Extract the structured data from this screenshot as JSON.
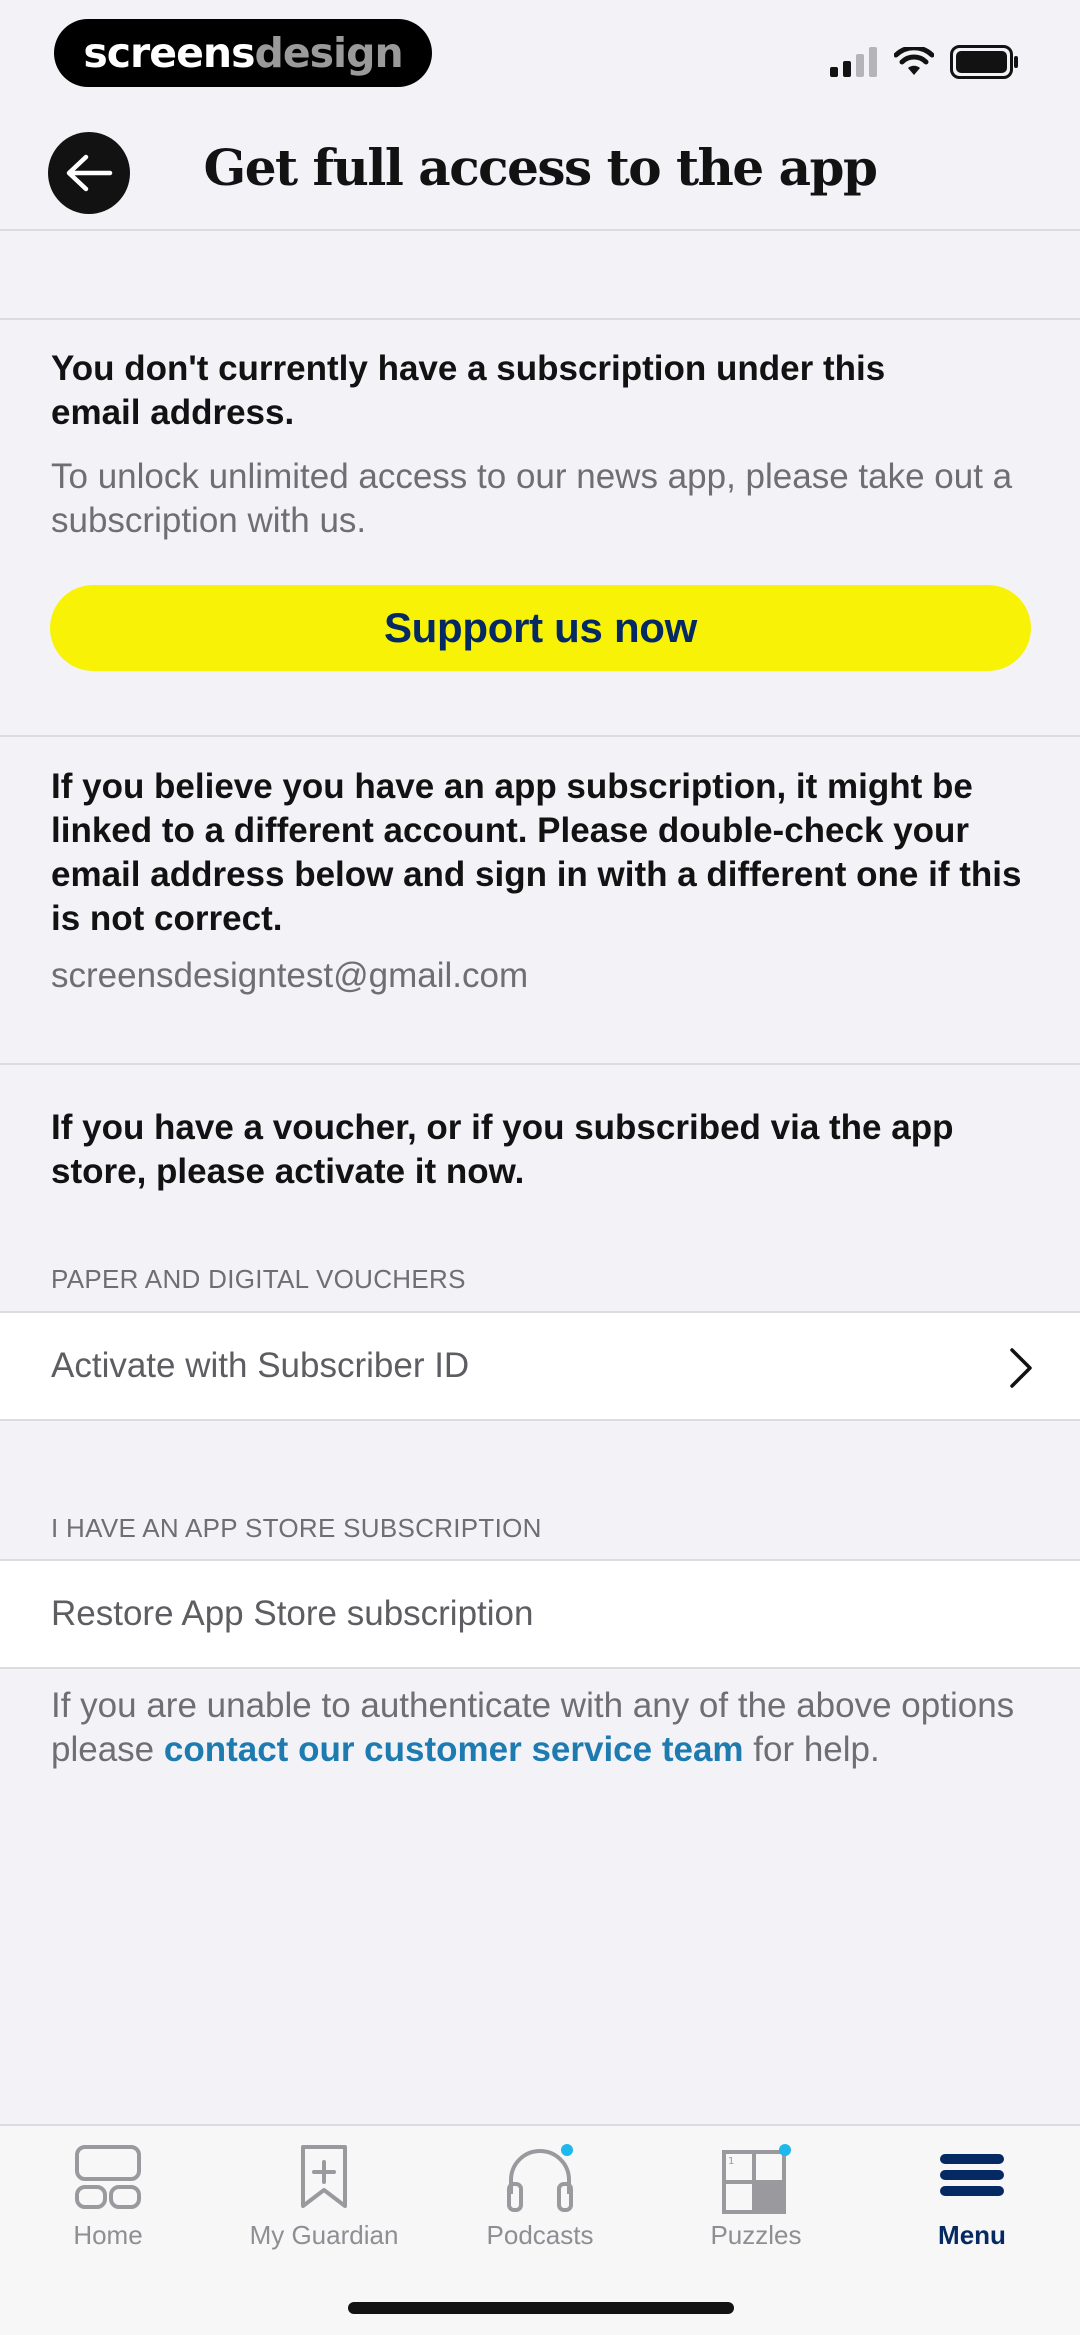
{
  "status_bar": {
    "brand_part1": "screens",
    "brand_part2": "design"
  },
  "header": {
    "title": "Get full access to the app"
  },
  "no_subscription": {
    "heading": "You don't currently have a subscription under this email address.",
    "body": "To unlock unlimited access to our news app, please take out a subscription with us.",
    "button_label": "Support us now"
  },
  "account_check": {
    "heading": "If you believe you have an app subscription, it might be linked to a different account. Please double-check your email address below and sign in with a different one if this is not correct.",
    "email": "screensdesigntest@gmail.com"
  },
  "voucher": {
    "heading": "If you have a voucher, or if you subscribed via the app store, please activate it now."
  },
  "paper_vouchers": {
    "group_label": "PAPER AND DIGITAL VOUCHERS",
    "row_label": "Activate with Subscriber ID"
  },
  "app_store": {
    "group_label": "I HAVE AN APP STORE SUBSCRIPTION",
    "row_label": "Restore App Store subscription"
  },
  "footnote": {
    "before": "If you are unable to authenticate with any of the above options please ",
    "link": "contact our customer service team",
    "after": " for help."
  },
  "tabs": [
    {
      "label": "Home",
      "icon": "home-icon"
    },
    {
      "label": "My Guardian",
      "icon": "bookmark-icon"
    },
    {
      "label": "Podcasts",
      "icon": "headphones-icon"
    },
    {
      "label": "Puzzles",
      "icon": "puzzle-grid-icon"
    },
    {
      "label": "Menu",
      "icon": "menu-icon"
    }
  ],
  "colors": {
    "background": "#f2f2f7",
    "support_button": "#f8f207",
    "brand_navy": "#052962",
    "link": "#1e7bb0",
    "notification_dot": "#1fb8ec"
  }
}
